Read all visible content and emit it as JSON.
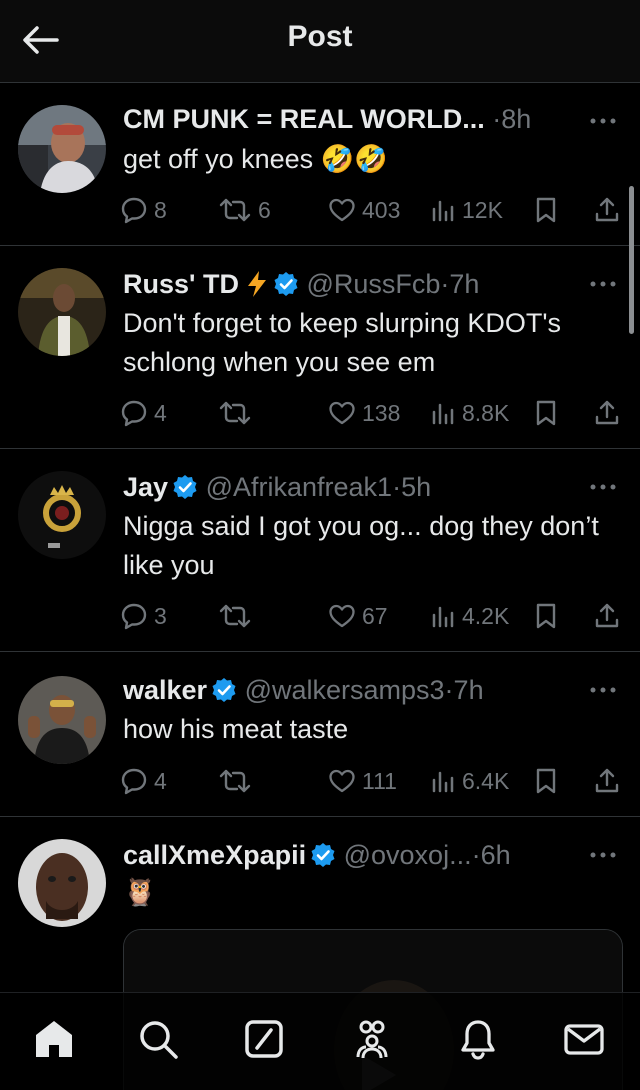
{
  "header": {
    "title": "Post",
    "back_icon": "arrow-left-icon"
  },
  "tweets": [
    {
      "name": "CM PUNK = REAL WORLD...",
      "handle": "",
      "time": "8h",
      "verified": false,
      "text": "get off yo knees 🤣🤣",
      "replies": "8",
      "retweets": "6",
      "likes": "403",
      "views": "12K"
    },
    {
      "name": "Russ' TD",
      "handle": "@RussFcb",
      "time": "7h",
      "verified": true,
      "text": "Don't forget to keep slurping KDOT's schlong when you see em",
      "replies": "4",
      "retweets": "",
      "likes": "138",
      "views": "8.8K"
    },
    {
      "name": "Jay",
      "handle": "@Afrikanfreak1",
      "time": "5h",
      "verified": true,
      "text": "Nigga said I got you og... dog they don’t like you",
      "replies": "3",
      "retweets": "",
      "likes": "67",
      "views": "4.2K"
    },
    {
      "name": "walker",
      "handle": "@walkersamps3",
      "time": "7h",
      "verified": true,
      "text": "how his meat taste",
      "replies": "4",
      "retweets": "",
      "likes": "111",
      "views": "6.4K"
    },
    {
      "name": "callXmeXpapii",
      "handle": "@ovoxoj...",
      "time": "6h",
      "verified": true,
      "text": "🦉"
    }
  ],
  "separator": "·",
  "colors": {
    "background": "#000000",
    "text": "#e7e9ea",
    "muted": "#71767b",
    "verified": "#1d9bf0",
    "bolt": "#f5a623",
    "divider": "#2f3336"
  },
  "bottom_nav": {
    "items": [
      "home-icon",
      "search-icon",
      "grok-icon",
      "communities-icon",
      "notifications-icon",
      "messages-icon"
    ]
  }
}
